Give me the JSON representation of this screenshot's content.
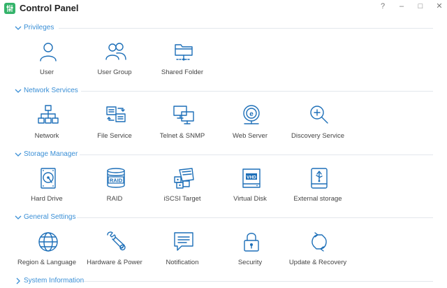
{
  "app": {
    "title": "Control Panel"
  },
  "window_controls": {
    "help": "?",
    "minimize": "–",
    "maximize": "□",
    "close": "✕"
  },
  "sections": {
    "privileges": {
      "title": "Privileges",
      "items": [
        {
          "label": "User",
          "icon": "user-icon"
        },
        {
          "label": "User Group",
          "icon": "user-group-icon"
        },
        {
          "label": "Shared Folder",
          "icon": "shared-folder-icon"
        }
      ]
    },
    "network": {
      "title": "Network Services",
      "items": [
        {
          "label": "Network",
          "icon": "network-icon"
        },
        {
          "label": "File Service",
          "icon": "file-service-icon"
        },
        {
          "label": "Telnet & SNMP",
          "icon": "telnet-snmp-icon"
        },
        {
          "label": "Web Server",
          "icon": "web-server-icon"
        },
        {
          "label": "Discovery Service",
          "icon": "discovery-service-icon"
        }
      ]
    },
    "storage": {
      "title": "Storage Manager",
      "items": [
        {
          "label": "Hard Drive",
          "icon": "hard-drive-icon"
        },
        {
          "label": "RAID",
          "icon": "raid-icon",
          "icon_text": "RAID"
        },
        {
          "label": "iSCSI Target",
          "icon": "iscsi-target-icon"
        },
        {
          "label": "Virtual Disk",
          "icon": "virtual-disk-icon",
          "icon_text": "VHD"
        },
        {
          "label": "External storage",
          "icon": "external-storage-icon"
        }
      ]
    },
    "general": {
      "title": "General Settings",
      "items": [
        {
          "label": "Region & Language",
          "icon": "globe-icon"
        },
        {
          "label": "Hardware & Power",
          "icon": "wrench-icon"
        },
        {
          "label": "Notification",
          "icon": "notification-icon"
        },
        {
          "label": "Security",
          "icon": "lock-icon"
        },
        {
          "label": "Update & Recovery",
          "icon": "update-recovery-icon"
        }
      ]
    },
    "system": {
      "title": "System Information",
      "collapsed": true
    }
  },
  "colors": {
    "accent": "#3a8fd6",
    "icon": "#1d6fb8",
    "divider": "#e3e7ec",
    "app_icon": "#34b36a"
  }
}
